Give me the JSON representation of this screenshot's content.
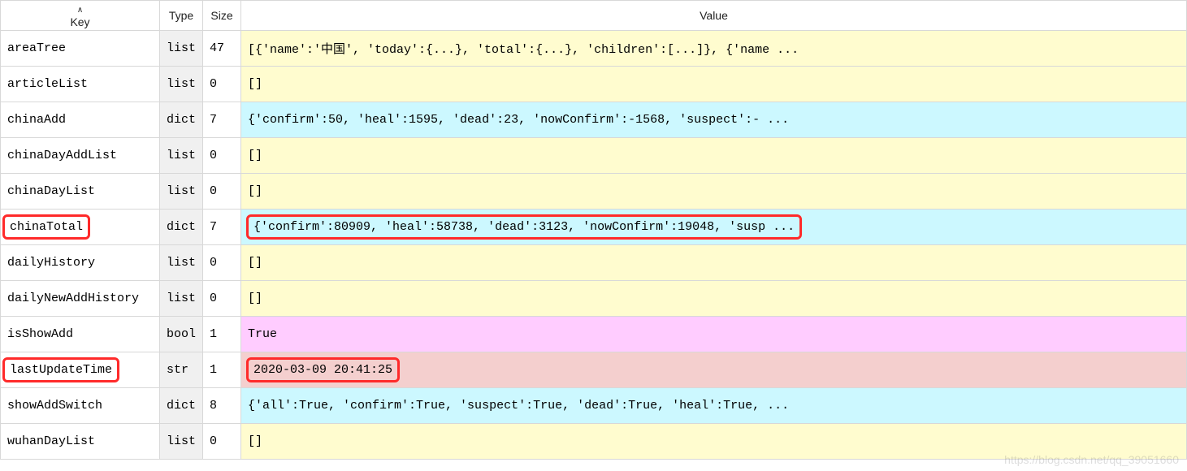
{
  "headers": {
    "key": "Key",
    "type": "Type",
    "size": "Size",
    "value": "Value"
  },
  "rows": [
    {
      "key": "areaTree",
      "type": "list",
      "size": "47",
      "vclass": "bg-list",
      "value": "[{'name':'中国', 'today':{...}, 'total':{...}, 'children':[...]}, {'name ..."
    },
    {
      "key": "articleList",
      "type": "list",
      "size": "0",
      "vclass": "bg-list",
      "value": "[]"
    },
    {
      "key": "chinaAdd",
      "type": "dict",
      "size": "7",
      "vclass": "bg-dict",
      "value": "{'confirm':50, 'heal':1595, 'dead':23, 'nowConfirm':-1568, 'suspect':- ..."
    },
    {
      "key": "chinaDayAddList",
      "type": "list",
      "size": "0",
      "vclass": "bg-list",
      "value": "[]"
    },
    {
      "key": "chinaDayList",
      "type": "list",
      "size": "0",
      "vclass": "bg-list",
      "value": "[]"
    },
    {
      "key": "chinaTotal",
      "type": "dict",
      "size": "7",
      "vclass": "bg-dict",
      "value": "{'confirm':80909, 'heal':58738, 'dead':3123, 'nowConfirm':19048, 'susp ...",
      "hl_key": true,
      "hl_value": true
    },
    {
      "key": "dailyHistory",
      "type": "list",
      "size": "0",
      "vclass": "bg-list",
      "value": "[]"
    },
    {
      "key": "dailyNewAddHistory",
      "type": "list",
      "size": "0",
      "vclass": "bg-list",
      "value": "[]"
    },
    {
      "key": "isShowAdd",
      "type": "bool",
      "size": "1",
      "vclass": "bg-bool",
      "value": "True"
    },
    {
      "key": "lastUpdateTime",
      "type": "str",
      "size": "1",
      "vclass": "bg-str",
      "value": "2020-03-09 20:41:25",
      "hl_key": true,
      "hl_value": true
    },
    {
      "key": "showAddSwitch",
      "type": "dict",
      "size": "8",
      "vclass": "bg-dict",
      "value": "{'all':True, 'confirm':True, 'suspect':True, 'dead':True, 'heal':True, ..."
    },
    {
      "key": "wuhanDayList",
      "type": "list",
      "size": "0",
      "vclass": "bg-list",
      "value": "[]"
    }
  ],
  "watermark": "https://blog.csdn.net/qq_39051660"
}
